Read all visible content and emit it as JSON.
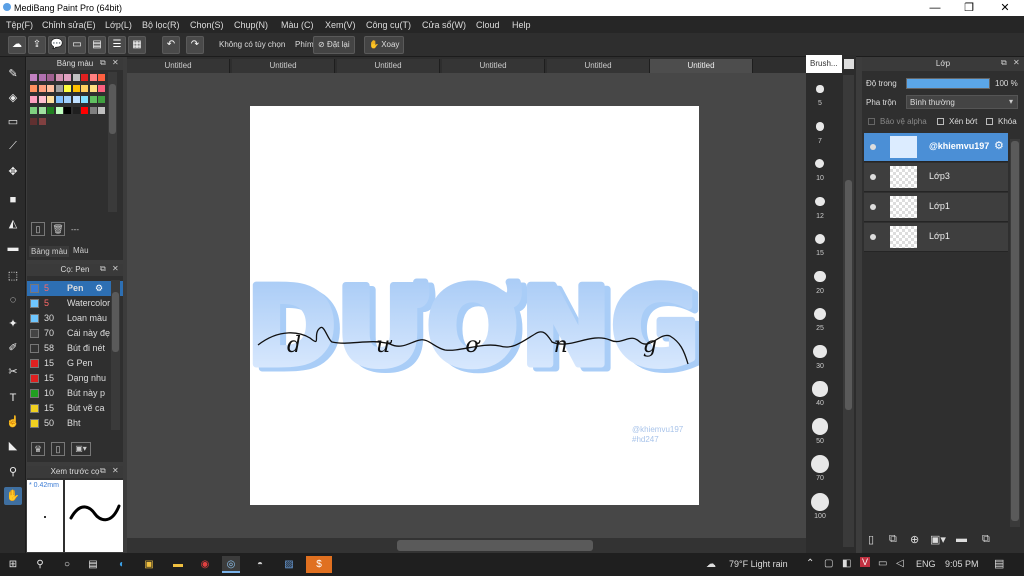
{
  "window": {
    "title": "MediBang Paint Pro (64bit)",
    "min": "—",
    "max": "❐",
    "close": "✕"
  },
  "menu": [
    "Tệp(F)",
    "Chỉnh sửa(E)",
    "Lớp(L)",
    "Bộ lọc(R)",
    "Chọn(S)",
    "Chụp(N)",
    "Màu (C)",
    "Xem(V)",
    "Công cụ(T)",
    "Cửa sổ(W)",
    "Cloud",
    "Help"
  ],
  "toolbar": {
    "no_option": "Không có tùy chọn",
    "key_label": "Phím",
    "reset": "Đặt lại",
    "rotate": "Xoay"
  },
  "color_panel": {
    "title": "Bảng màu",
    "footer_dash": "---",
    "tab_palette": "Bảng màu",
    "tab_color": "Màu"
  },
  "brush_panel": {
    "title": "Cọ: Pen",
    "items": [
      {
        "size": "5",
        "name": "Pen",
        "color": "#3a7bd5"
      },
      {
        "size": "5",
        "name": "Watercolor",
        "color": "#6ec6ff"
      },
      {
        "size": "30",
        "name": "Loan màu",
        "color": "#6ec6ff"
      },
      {
        "size": "70",
        "name": "Cái này đẹ",
        "color": "#444444"
      },
      {
        "size": "58",
        "name": "Bút đi nét",
        "color": "#333333"
      },
      {
        "size": "15",
        "name": "G Pen",
        "color": "#e02020"
      },
      {
        "size": "15",
        "name": "Dạng nhu",
        "color": "#e02020"
      },
      {
        "size": "10",
        "name": "Bút này p",
        "color": "#20a020"
      },
      {
        "size": "15",
        "name": "Bút vẽ ca",
        "color": "#f0d020"
      },
      {
        "size": "50",
        "name": "Bht",
        "color": "#f0d020"
      }
    ]
  },
  "preview_panel": {
    "title": "Xem trước cọ",
    "size": "0.42mm"
  },
  "tabs": [
    "Untitled",
    "Untitled",
    "Untitled",
    "Untitled",
    "Untitled",
    "Untitled"
  ],
  "canvas": {
    "big_text": "DƯƠNG",
    "script_text": "dương",
    "watermark1": "@khiemvu197",
    "watermark2": "#hd247"
  },
  "brush_sizes": {
    "title": "Brush...",
    "sizes": [
      "5",
      "7",
      "10",
      "12",
      "15",
      "20",
      "25",
      "30",
      "40",
      "50",
      "70",
      "100"
    ]
  },
  "layer_panel": {
    "title": "Lớp",
    "opacity_label": "Độ trong",
    "opacity_value": "100 %",
    "opacity": 1.0,
    "blend_label": "Pha trộn",
    "blend_value": "Bình thường",
    "protect_alpha": "Bảo vệ alpha",
    "clip": "Xén bớt",
    "lock": "Khóa",
    "layers": [
      "@khiemvu197",
      "Lớp3",
      "Lớp1",
      "Lớp1"
    ]
  },
  "taskbar": {
    "weather": "79°F  Light rain",
    "lang": "ENG",
    "time": "9:05 PM"
  },
  "colors": {
    "accent": "#2d6fb3",
    "text_blue": "#a9cdf7",
    "text_blue_light": "#d9eaff"
  }
}
